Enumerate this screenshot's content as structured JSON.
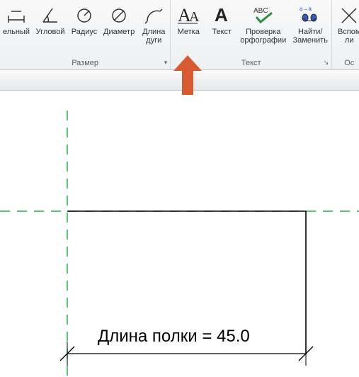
{
  "ribbon": {
    "groups": [
      {
        "title": "Размер",
        "dropdown": "▾",
        "items": [
          {
            "label": "ельный",
            "icon": "linear-dim-icon"
          },
          {
            "label": "Угловой",
            "icon": "angular-dim-icon"
          },
          {
            "label": "Радиус",
            "icon": "radius-dim-icon"
          },
          {
            "label": "Диаметр",
            "icon": "diameter-dim-icon"
          },
          {
            "label": "Длина\nдуги",
            "icon": "arc-length-icon"
          }
        ]
      },
      {
        "title": "Текст",
        "launcher": "↘",
        "items": [
          {
            "label": "Метка",
            "icon": "label-icon"
          },
          {
            "label": "Текст",
            "icon": "text-icon"
          },
          {
            "label": "Проверка\nорфографии",
            "icon": "spellcheck-icon"
          },
          {
            "label": "Найти/\nЗаменить",
            "icon": "find-replace-icon"
          }
        ]
      },
      {
        "title": "Ос",
        "items": [
          {
            "label": "Вспом\nли",
            "icon": "aux-icon"
          }
        ]
      }
    ]
  },
  "drawing": {
    "annotation": "Длина полки = 45.0"
  },
  "colors": {
    "arrow": "#d85a32",
    "guide": "#2bb24c"
  }
}
